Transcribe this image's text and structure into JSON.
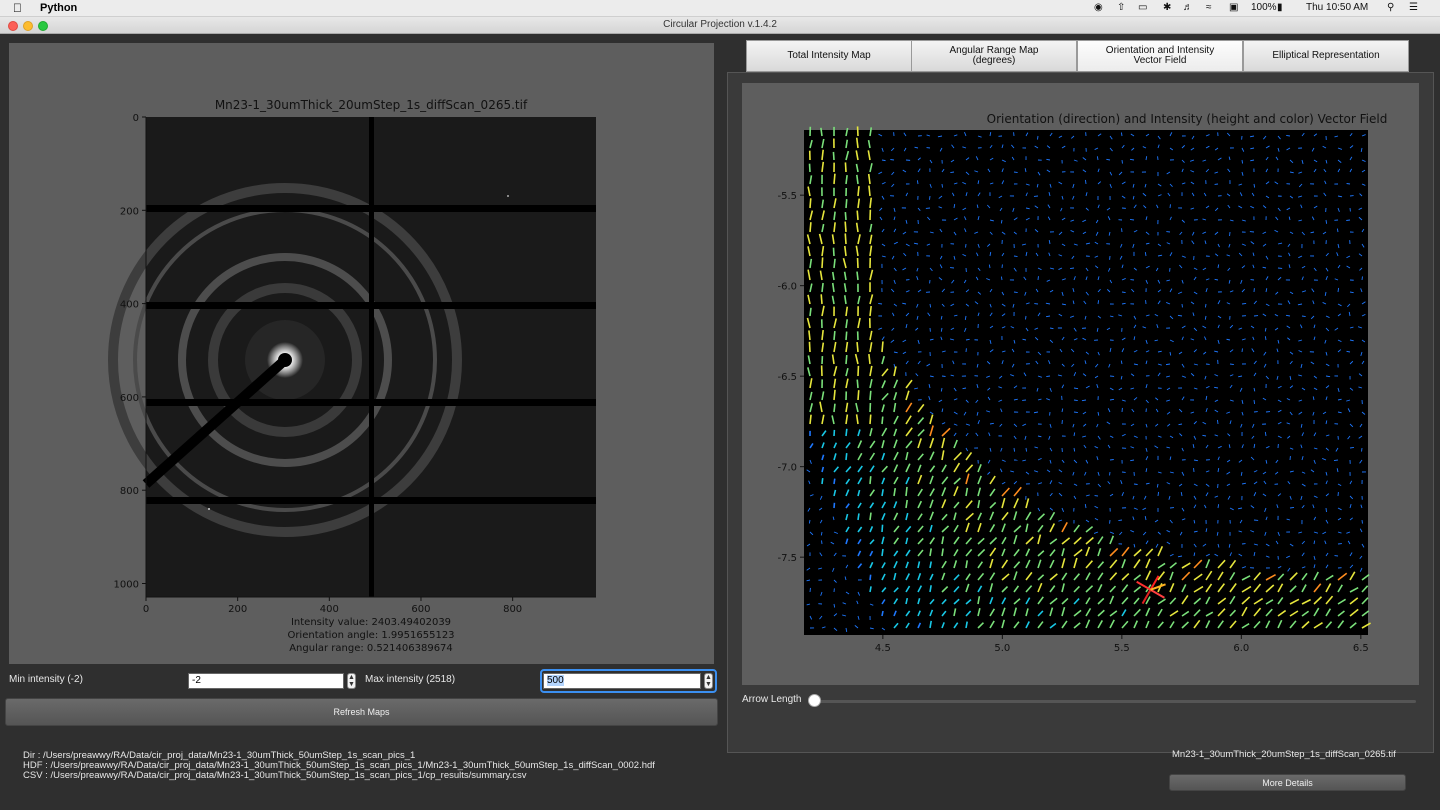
{
  "menubar": {
    "app_name": "Python",
    "battery": "100%",
    "datetime": "Thu 10:50 AM"
  },
  "window": {
    "title": "Circular Projection v.1.4.2"
  },
  "left_plot": {
    "title": "Mn23-1_30umThick_20umStep_1s_diffScan_0265.tif",
    "x_ticks": [
      "0",
      "200",
      "400",
      "600",
      "800"
    ],
    "y_ticks": [
      "0",
      "200",
      "400",
      "600",
      "800",
      "1000"
    ],
    "intensity_value": "Intensity value: 2403.49402039",
    "orientation_angle": "Orientation angle: 1.9951655123",
    "angular_range": "Angular range: 0.521406389674"
  },
  "controls": {
    "min_label": "Min intensity (-2)",
    "min_value": "-2",
    "max_label": "Max intensity (2518)",
    "max_value": "500",
    "refresh_label": "Refresh Maps",
    "arrow_length_label": "Arrow Length",
    "arrow_length_value": 0
  },
  "tabs": [
    {
      "label1": "Total Intensity Map",
      "label2": ""
    },
    {
      "label1": "Angular Range Map",
      "label2": "(degrees)"
    },
    {
      "label1": "Orientation and Intensity",
      "label2": "Vector Field"
    },
    {
      "label1": "Elliptical Representation",
      "label2": ""
    }
  ],
  "active_tab": 2,
  "chart_data": {
    "type": "quiver",
    "title": "Orientation (direction) and Intensity (height and color) Vector Field",
    "xlabel": "",
    "ylabel": "",
    "x_ticks": [
      "4.5",
      "5.0",
      "5.5",
      "6.0",
      "6.5"
    ],
    "y_ticks": [
      "-5.5",
      "-6.0",
      "-6.5",
      "-7.0",
      "-7.5"
    ],
    "xlim": [
      4.17,
      6.53
    ],
    "ylim": [
      -7.93,
      -5.14
    ],
    "background": "#000000"
  },
  "footer": {
    "dir": "Dir : /Users/preawwy/RA/Data/cir_proj_data/Mn23-1_30umThick_50umStep_1s_scan_pics_1",
    "hdf": "HDF : /Users/preawwy/RA/Data/cir_proj_data/Mn23-1_30umThick_50umStep_1s_scan_pics_1/Mn23-1_30umThick_50umStep_1s_diffScan_0002.hdf",
    "csv": "CSV : /Users/preawwy/RA/Data/cir_proj_data/Mn23-1_30umThick_50umStep_1s_scan_pics_1/cp_results/summary.csv",
    "filename": "Mn23-1_30umThick_20umStep_1s_diffScan_0265.tif",
    "more_details": "More Details"
  },
  "colors": {
    "panel_gray": "#5e5e5e",
    "dark_bg": "#2f2f2f",
    "focus_blue": "#3b8ff0"
  }
}
